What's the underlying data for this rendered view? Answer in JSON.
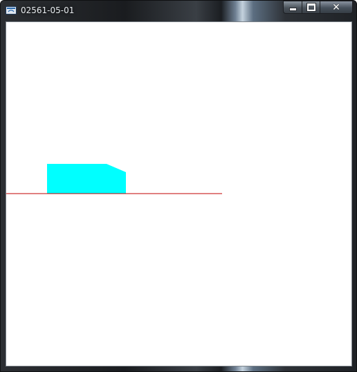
{
  "window": {
    "title": "02561-05-01",
    "icon": "app-window-icon",
    "controls": {
      "minimize": "minimize-icon",
      "maximize": "maximize-icon",
      "close": "close-icon"
    }
  },
  "scene": {
    "shape_color": "#00ffff",
    "line_color": "#c00000",
    "background": "#ffffff"
  }
}
